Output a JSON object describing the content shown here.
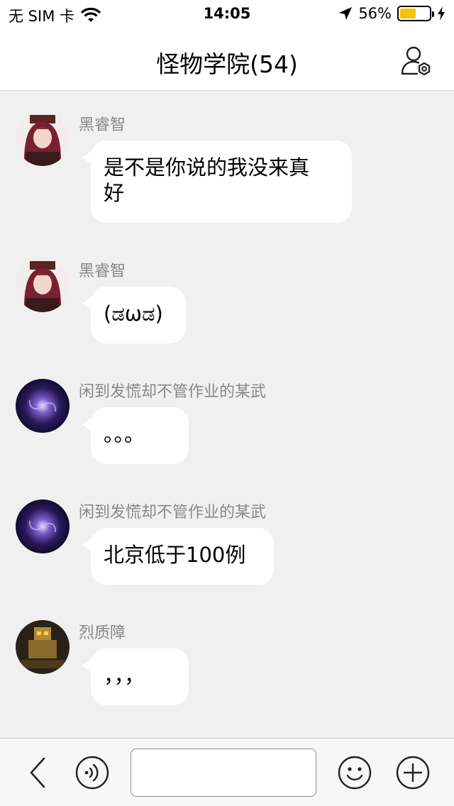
{
  "status_bar": {
    "carrier": "无 SIM 卡",
    "time": "14:05",
    "battery_percent": "56%",
    "battery_level": 0.56,
    "icons": [
      "wifi-icon",
      "location-arrow-icon",
      "battery-icon",
      "charging-icon"
    ]
  },
  "header": {
    "title": "怪物学院(54)",
    "settings_icon": "group-settings-icon"
  },
  "messages": [
    {
      "sender": "黑睿智",
      "text_lines": [
        "是不是你说的我没来真",
        "好"
      ],
      "avatar": "anime-girl-avatar"
    },
    {
      "sender": "黑睿智",
      "text_lines": [
        "(ಡωಡ)"
      ],
      "avatar": "anime-girl-avatar"
    },
    {
      "sender": "闲到发慌却不管作业的某武",
      "text_lines": [
        "。。。"
      ],
      "avatar": "galaxy-avatar"
    },
    {
      "sender": "闲到发慌却不管作业的某武",
      "text_lines": [
        "北京低于100例"
      ],
      "avatar": "galaxy-avatar"
    },
    {
      "sender": "烈质障",
      "text_lines": [
        "，，，"
      ],
      "avatar": "robot-avatar"
    }
  ],
  "input_bar": {
    "value": "",
    "placeholder": "",
    "icons": [
      "back-chevron-icon",
      "voice-icon",
      "emoji-icon",
      "plus-icon"
    ]
  },
  "colors": {
    "background": "#f0f0f0",
    "bubble": "#ffffff",
    "sender_text": "#888888",
    "battery_fill": "#f5c400"
  }
}
